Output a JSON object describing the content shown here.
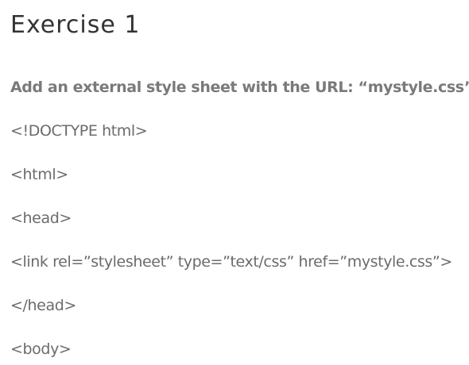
{
  "exercise": {
    "title": "Exercise 1",
    "instruction": "Add an external style sheet with the URL: “mystyle.css”.",
    "code_lines": [
      "<!DOCTYPE html>",
      "<html>",
      "<head>",
      "<link rel=”stylesheet” type=”text/css” href=”mystyle.css”>",
      "</head>",
      "<body>"
    ]
  },
  "colors": {
    "title": "#333333",
    "instruction": "#7a7a7a",
    "code": "#6b6b6b",
    "background": "#ffffff"
  }
}
